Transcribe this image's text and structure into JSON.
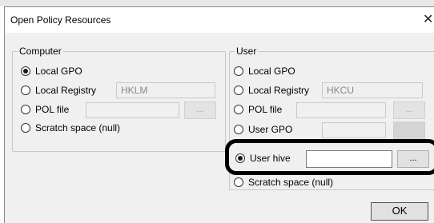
{
  "dialog": {
    "title": "Open Policy Resources",
    "close_glyph": "✕",
    "ok_label": "OK"
  },
  "computer": {
    "legend": "Computer",
    "options": [
      {
        "label": "Local GPO",
        "checked": true
      },
      {
        "label": "Local Registry",
        "value": "HKLM"
      },
      {
        "label": "POL file",
        "value": "",
        "browse": "..."
      },
      {
        "label": "Scratch space (null)"
      }
    ]
  },
  "user": {
    "legend": "User",
    "options": [
      {
        "label": "Local GPO"
      },
      {
        "label": "Local Registry",
        "value": "HKCU"
      },
      {
        "label": "POL file",
        "value": "",
        "browse": "..."
      },
      {
        "label": "User GPO",
        "value": "",
        "browse": ""
      },
      {
        "label": "User hive",
        "value": "",
        "browse": "...",
        "checked": true
      },
      {
        "label": "Scratch space (null)"
      }
    ]
  },
  "icons": {
    "close": "close-icon",
    "radio": "radio-icon"
  }
}
